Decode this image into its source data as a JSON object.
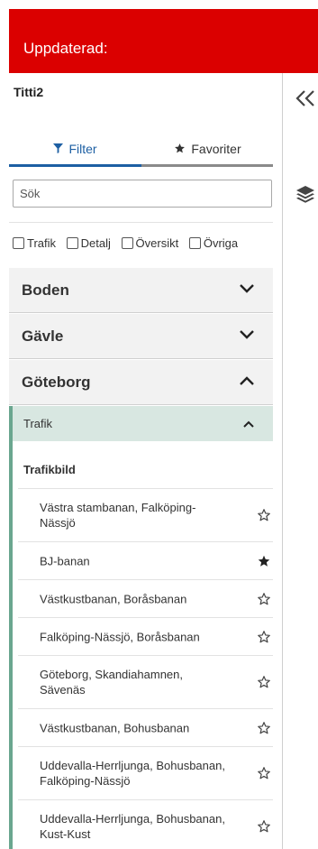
{
  "header": {
    "title": "Uppdaterad:"
  },
  "panel": {
    "title": "Titti2"
  },
  "tabs": {
    "filter_label": "Filter",
    "favorites_label": "Favoriter",
    "active": "filter"
  },
  "search": {
    "placeholder": "Sök"
  },
  "checkboxes": [
    "Trafik",
    "Detalj",
    "Översikt",
    "Övriga"
  ],
  "groups": [
    {
      "label": "Boden",
      "expanded": false
    },
    {
      "label": "Gävle",
      "expanded": false
    },
    {
      "label": "Göteborg",
      "expanded": true
    }
  ],
  "subgroup": {
    "label": "Trafik",
    "expanded": true
  },
  "list": {
    "header": "Trafikbild",
    "items": [
      {
        "label": "Västra stambanan, Falköping-Nässjö",
        "favorite": false
      },
      {
        "label": "BJ-banan",
        "favorite": true
      },
      {
        "label": "Västkustbanan, Boråsbanan",
        "favorite": false
      },
      {
        "label": "Falköping-Nässjö, Boråsbanan",
        "favorite": false
      },
      {
        "label": "Göteborg, Skandiahamnen, Sävenäs",
        "favorite": false
      },
      {
        "label": "Västkustbanan, Bohusbanan",
        "favorite": false
      },
      {
        "label": "Uddevalla-Herrljunga, Bohusbanan, Falköping-Nässjö",
        "favorite": false
      },
      {
        "label": "Uddevalla-Herrljunga, Bohusbanan, Kust-Kust",
        "favorite": false
      }
    ]
  },
  "colors": {
    "brand_red": "#db0000",
    "accent_blue": "#1d5fa3",
    "trafik_green": "#6aa68f"
  },
  "icons": {
    "collapse": "double-chevron-left-icon",
    "layers": "layers-icon",
    "filter": "filter-icon",
    "favorites": "star-icon"
  }
}
